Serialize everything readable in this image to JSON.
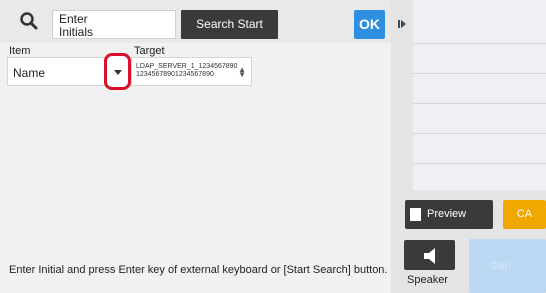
{
  "search": {
    "initials_placeholder": "Enter\nInitials",
    "search_start_label": "Search Start",
    "ok_label": "OK"
  },
  "columns": {
    "item_label": "Item",
    "target_label": "Target"
  },
  "item": {
    "value": "Name"
  },
  "target": {
    "value": "LDAP_SERVER_1_1234567890 12345678901234567890"
  },
  "footer": {
    "message": "Enter Initial and press Enter key of external keyboard or [Start Search] button."
  },
  "right_panel": {
    "preview_label": "Preview",
    "ca_label": "CA",
    "speaker_label": "Speaker",
    "start_label": "Start"
  },
  "colors": {
    "ok": "#2f8fe0",
    "ca": "#f0a700",
    "highlight": "#d8102a",
    "start": "#bcd8f2"
  }
}
